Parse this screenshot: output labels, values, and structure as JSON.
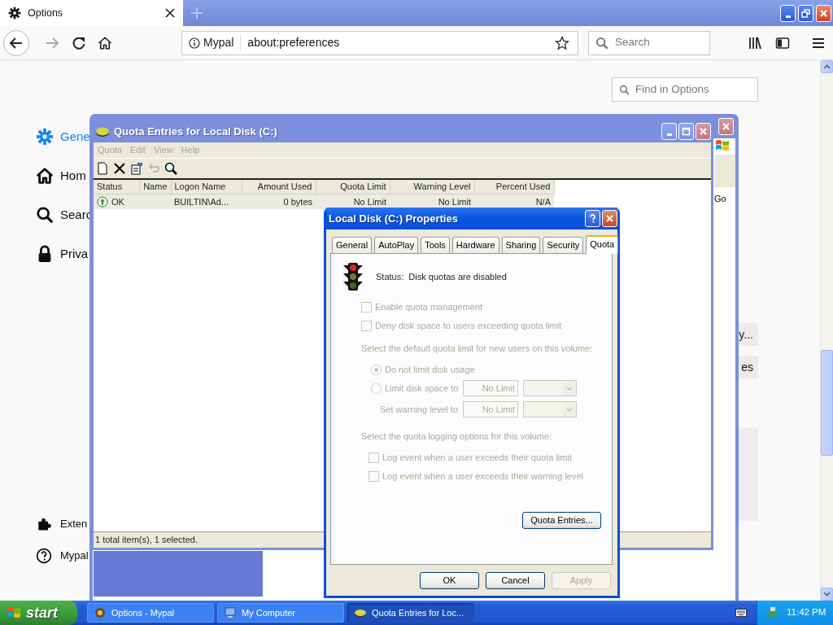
{
  "browser": {
    "tab": {
      "title": "Options"
    },
    "identity": "Mypal",
    "url": "about:preferences",
    "search": {
      "placeholder": "Search"
    },
    "find": {
      "placeholder": "Find in Options"
    },
    "sidebar": [
      {
        "label": "Gene",
        "kind": "gear",
        "selected": true
      },
      {
        "label": "Hom",
        "kind": "home",
        "selected": false
      },
      {
        "label": "Searc",
        "kind": "search",
        "selected": false
      },
      {
        "label": "Priva",
        "kind": "lock",
        "selected": false
      }
    ],
    "footer_links": [
      {
        "label": "Exten",
        "kind": "puzzle"
      },
      {
        "label": "Mypal",
        "kind": "help"
      }
    ],
    "fragments": [
      "y...",
      "es"
    ]
  },
  "back_window": {
    "go_label": "Go"
  },
  "quota_window": {
    "title": "Quota Entries for Local Disk (C:)",
    "menu": [
      "Quota",
      "Edit",
      "View",
      "Help"
    ],
    "columns": [
      "Status",
      "Name",
      "Logon Name",
      "Amount Used",
      "Quota Limit",
      "Warning Level",
      "Percent Used"
    ],
    "rows": [
      {
        "status": "OK",
        "logon": "BUILTIN\\Ad...",
        "amount": "0 bytes",
        "quota": "No Limit",
        "warning": "No Limit",
        "percent": "N/A",
        "selected": true
      }
    ],
    "status_text": "1 total item(s), 1 selected."
  },
  "dialog": {
    "title": "Local Disk (C:) Properties",
    "tabs": [
      {
        "label": "General",
        "selected": false
      },
      {
        "label": "AutoPlay",
        "selected": false
      },
      {
        "label": "Tools",
        "selected": false
      },
      {
        "label": "Hardware",
        "selected": false
      },
      {
        "label": "Sharing",
        "selected": false
      },
      {
        "label": "Security",
        "selected": false
      },
      {
        "label": "Quota",
        "selected": true
      }
    ],
    "status": "Status:  Disk quotas are disabled",
    "settings_disabled": true,
    "checks": [
      {
        "label": "Enable quota management",
        "checked": false
      },
      {
        "label": "Deny disk space to users exceeding quota limit",
        "checked": false
      }
    ],
    "default_label": "Select the default quota limit for new users on this volume:",
    "radios": [
      {
        "label": "Do not limit disk usage",
        "selected": true
      },
      {
        "label": "Limit disk space to",
        "selected": false
      }
    ],
    "limit_value": "No Limit",
    "warning_label": "Set warning level to",
    "warning_value": "No Limit",
    "logging_label": "Select the quota logging options for this volume:",
    "log_checks": [
      {
        "label": "Log event when a user exceeds their quota limit",
        "checked": false
      },
      {
        "label": "Log event when a user exceeds their warning level",
        "checked": false
      }
    ],
    "entries_button": "Quota Entries...",
    "buttons": [
      {
        "label": "OK",
        "disabled": false
      },
      {
        "label": "Cancel",
        "disabled": false
      },
      {
        "label": "Apply",
        "disabled": true
      }
    ]
  },
  "taskbar": {
    "start": "start",
    "tasks": [
      {
        "label": "Options - Mypal",
        "kind": "browser",
        "selected": false
      },
      {
        "label": "My Computer",
        "kind": "computer",
        "selected": false
      },
      {
        "label": "Quota Entries for Loc...",
        "kind": "disk",
        "selected": true
      }
    ],
    "clock": "11:42 PM"
  }
}
